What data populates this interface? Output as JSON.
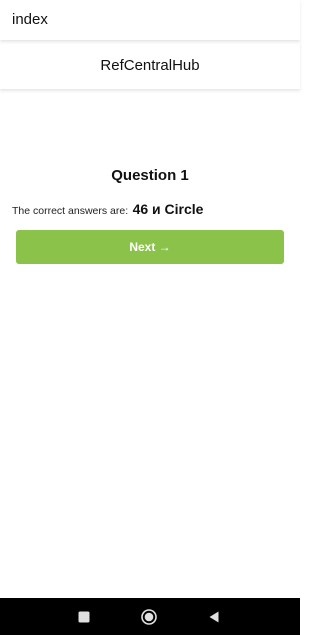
{
  "app_bar": {
    "title": "index"
  },
  "header": {
    "title": "RefCentralHub"
  },
  "quiz": {
    "question_title": "Question 1",
    "answer_prefix": "The correct answers are:",
    "answer_value": "46 и Circle",
    "next_label": "Next →"
  },
  "nav_bar": {
    "icons": [
      "recents-icon",
      "home-icon",
      "back-icon"
    ]
  },
  "colors": {
    "accent": "#8bc34a",
    "nav_background": "#000000",
    "nav_icon": "#e0e0e0"
  }
}
